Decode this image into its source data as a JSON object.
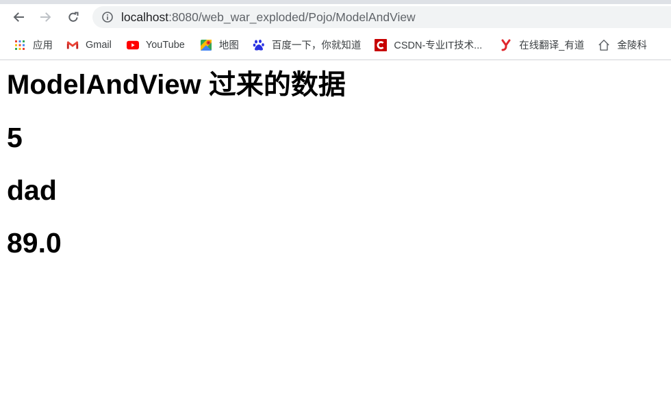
{
  "browser": {
    "url_host": "localhost",
    "url_rest": ":8080/web_war_exploded/Pojo/ModelAndView"
  },
  "bookmarks": [
    {
      "label": "应用",
      "icon": "apps-grid-icon"
    },
    {
      "label": "Gmail",
      "icon": "gmail-icon"
    },
    {
      "label": "YouTube",
      "icon": "youtube-icon"
    },
    {
      "label": "地图",
      "icon": "maps-icon"
    },
    {
      "label": "百度一下，你就知道",
      "icon": "baidu-icon"
    },
    {
      "label": "CSDN-专业IT技术...",
      "icon": "csdn-icon"
    },
    {
      "label": "在线翻译_有道",
      "icon": "youdao-icon"
    },
    {
      "label": "金陵科",
      "icon": "home-icon"
    }
  ],
  "page": {
    "title": "ModelAndView 过来的数据",
    "values": [
      "5",
      "dad",
      "89.0"
    ]
  },
  "colors": {
    "tab_strip": "#dee1e6",
    "omnibox_bg": "#f1f3f4",
    "youtube_red": "#ff0000",
    "csdn_red": "#c70000",
    "youdao_red": "#e0262c"
  }
}
